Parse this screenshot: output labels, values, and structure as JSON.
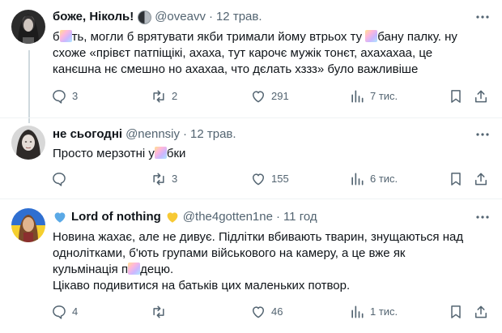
{
  "tweets": [
    {
      "name": "боже, Ніколь!",
      "handle": "@oveavv",
      "separator": "·",
      "time": "12 трав.",
      "text_lines": [
        [
          "б",
          "blur",
          "ть, могли б врятувати якби тримали йому втрьох ту ",
          "blur",
          "бану палку. ну"
        ],
        [
          "схоже «прівєт патпіщікі, ахаха, тут карочє мужік тонєт, ахахахаа, це"
        ],
        [
          "канєшна нє смешно но ахахаа, что дєлать хззз» було важливіше"
        ]
      ],
      "replies": "3",
      "retweets": "2",
      "likes": "291",
      "views": "7 тис."
    },
    {
      "name": "не сьогодні",
      "handle": "@nennsiy",
      "separator": "·",
      "time": "12 трав.",
      "text_lines": [
        [
          "Просто мерзотні у",
          "blur",
          "бки"
        ]
      ],
      "replies": "",
      "retweets": "3",
      "likes": "155",
      "views": "6 тис."
    },
    {
      "name": "Lord of nothing",
      "handle": "@the4gotten1ne",
      "separator": "·",
      "time": "11 год",
      "text_lines": [
        [
          "Новина жахає, але не дивує. Підлітки вбивають тварин, знущаються над"
        ],
        [
          "однолітками, б'ють групами військового на камеру, а це вже як"
        ],
        [
          "кульмінація п",
          "blur",
          "децю."
        ],
        [
          "Цікаво подивитися на батьків цих маленьких потвор."
        ]
      ],
      "replies": "4",
      "retweets": "",
      "likes": "46",
      "views": "1 тис."
    }
  ],
  "icons": {
    "reply": "reply-icon",
    "retweet": "retweet-icon",
    "like": "heart-icon",
    "views": "views-chart-icon",
    "bookmark": "bookmark-icon",
    "share": "share-icon",
    "more": "more-icon"
  },
  "colors": {
    "text": "#0f1419",
    "secondary": "#536471",
    "divider": "#eff3f4"
  }
}
